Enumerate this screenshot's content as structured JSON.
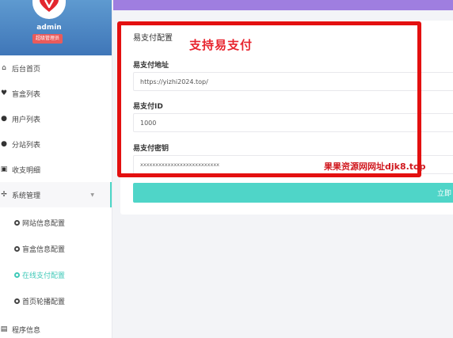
{
  "sidebar": {
    "admin_name": "admin",
    "admin_role": "超级管理员",
    "items": [
      {
        "label": "后台首页",
        "icon": "home-icon",
        "glyph": "⌂"
      },
      {
        "label": "盲盒列表",
        "icon": "heart-icon",
        "glyph": "♥"
      },
      {
        "label": "用户列表",
        "icon": "user-icon",
        "glyph": "●"
      },
      {
        "label": "分站列表",
        "icon": "user-icon",
        "glyph": "●"
      },
      {
        "label": "收支明细",
        "icon": "wallet-icon",
        "glyph": "▣"
      },
      {
        "label": "系统管理",
        "icon": "settings-icon",
        "glyph": "✢"
      }
    ],
    "sub_items": [
      {
        "label": "网站信息配置"
      },
      {
        "label": "盲盒信息配置"
      },
      {
        "label": "在线支付配置"
      },
      {
        "label": "首页轮播配置"
      }
    ],
    "bottom_item": {
      "label": "程序信息",
      "icon": "monitor-icon",
      "glyph": "▤"
    }
  },
  "card": {
    "title": "易支付配置",
    "overlay": "支持易支付",
    "fields": [
      {
        "label": "易支付地址",
        "value": "https://yizhi2024.top/"
      },
      {
        "label": "易支付ID",
        "value": "1000"
      },
      {
        "label": "易支付密钥",
        "value": "xxxxxxxxxxxxxxxxxxxxxxxxxx"
      }
    ],
    "submit_label": "立即"
  },
  "watermark": "果果资源网网址djk8.top",
  "colors": {
    "accent": "#4fd5c8",
    "topbar": "#9f7ee0",
    "profile": "#4a82c1",
    "highlight_frame": "#e31010"
  }
}
